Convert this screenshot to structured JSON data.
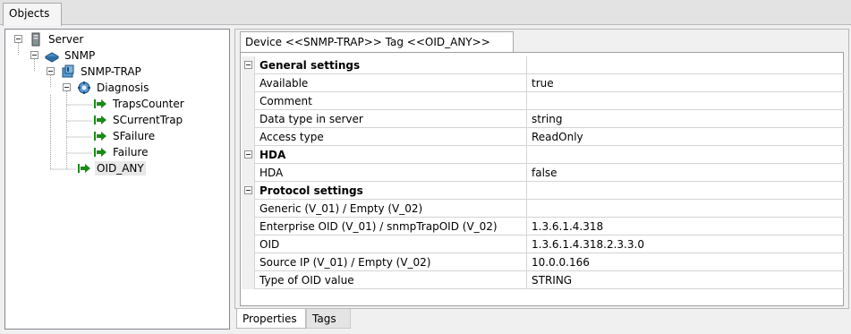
{
  "top_tab": {
    "label": "Objects"
  },
  "tree": {
    "nodes": [
      {
        "label": "Server",
        "icon": "server-icon"
      },
      {
        "label": "SNMP",
        "icon": "snmp-protocol-icon"
      },
      {
        "label": "SNMP-TRAP",
        "icon": "device-icon"
      },
      {
        "label": "Diagnosis",
        "icon": "diagnosis-icon"
      },
      {
        "label": "TrapsCounter",
        "icon": "tag-arrow-icon"
      },
      {
        "label": "SCurrentTrap",
        "icon": "tag-arrow-icon"
      },
      {
        "label": "SFailure",
        "icon": "tag-arrow-icon"
      },
      {
        "label": "Failure",
        "icon": "tag-arrow-icon"
      },
      {
        "label": "OID_ANY",
        "icon": "tag-arrow-icon",
        "selected": true
      }
    ]
  },
  "device_tab": {
    "label": "Device <<SNMP-TRAP>> Tag <<OID_ANY>>"
  },
  "grid": {
    "rows": [
      {
        "type": "category",
        "name": "General settings",
        "value": ""
      },
      {
        "type": "property",
        "name": "Available",
        "value": "true"
      },
      {
        "type": "property",
        "name": "Comment",
        "value": ""
      },
      {
        "type": "property",
        "name": "Data type in server",
        "value": "string"
      },
      {
        "type": "property",
        "name": "Access type",
        "value": "ReadOnly"
      },
      {
        "type": "category",
        "name": "HDA",
        "value": ""
      },
      {
        "type": "property",
        "name": "HDA",
        "value": "false"
      },
      {
        "type": "category",
        "name": "Protocol settings",
        "value": ""
      },
      {
        "type": "property",
        "name": "Generic (V_01) / Empty (V_02)",
        "value": ""
      },
      {
        "type": "property",
        "name": "Enterprise OID (V_01) / snmpTrapOID (V_02)",
        "value": "1.3.6.1.4.318"
      },
      {
        "type": "property",
        "name": "OID",
        "value": "1.3.6.1.4.318.2.3.3.0"
      },
      {
        "type": "property",
        "name": "Source IP (V_01) / Empty (V_02)",
        "value": "10.0.0.166"
      },
      {
        "type": "property",
        "name": "Type of OID value",
        "value": "STRING"
      }
    ]
  },
  "bottom_tabs": [
    {
      "label": "Properties",
      "active": true
    },
    {
      "label": "Tags",
      "active": false
    }
  ],
  "colors": {
    "tag_arrow": "#1a8a1a",
    "grid_line": "#d4d4d4"
  }
}
